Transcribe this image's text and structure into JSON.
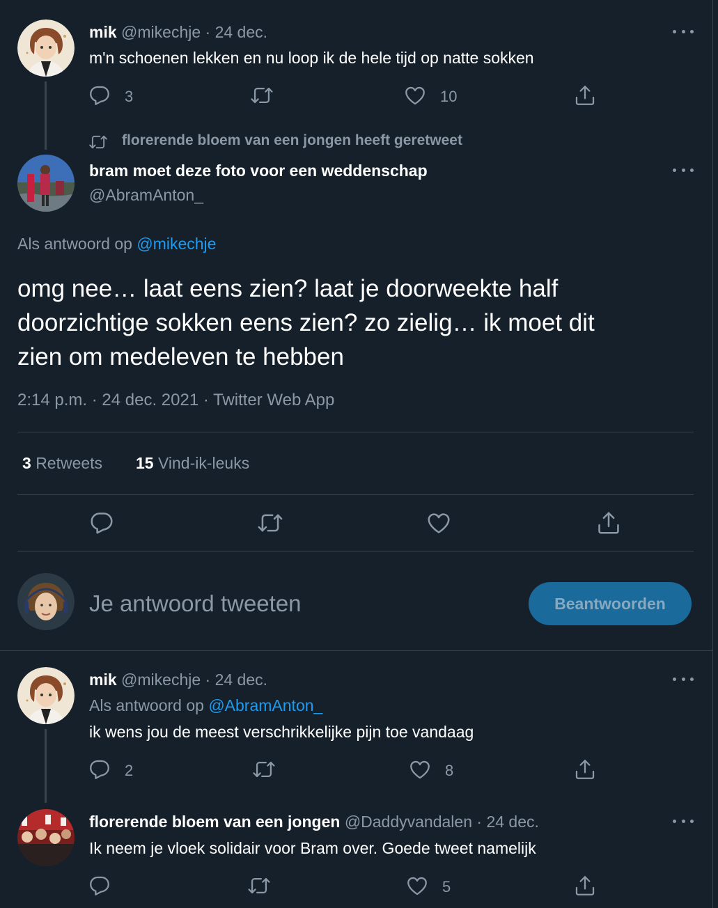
{
  "tweet1": {
    "name": "mik",
    "handle": "@mikechje",
    "date": "· 24 dec.",
    "text": "m'n schoenen lekken en nu loop ik de hele tijd op natte sokken",
    "reply_count": "3",
    "like_count": "10"
  },
  "retweet_banner": "florerende bloem van een jongen heeft geretweet",
  "main": {
    "name": "bram moet deze foto voor een weddenschap",
    "handle": "@AbramAnton_",
    "reply_prefix": "Als antwoord op",
    "reply_to": "@mikechje",
    "text_line1": "omg nee… laat eens zien? laat je doorweekte half",
    "text_line2": "doorzichtige sokken eens zien? zo zielig… ik moet dit",
    "text_line3": "zien om medeleven te hebben",
    "meta": "2:14 p.m. · 24 dec. 2021 · Twitter Web App",
    "retweets_count": "3",
    "retweets_label": "Retweets",
    "likes_count": "15",
    "likes_label": "Vind-ik-leuks"
  },
  "compose": {
    "placeholder": "Je antwoord tweeten",
    "button": "Beantwoorden"
  },
  "reply1": {
    "name": "mik",
    "handle": "@mikechje",
    "date": "· 24 dec.",
    "reply_prefix": "Als antwoord op",
    "reply_to": "@AbramAnton_",
    "text": "ik wens jou de meest verschrikkelijke pijn toe vandaag",
    "reply_count": "2",
    "like_count": "8"
  },
  "reply2": {
    "name": "florerende bloem van een jongen",
    "handle": "@Daddyvandalen",
    "date": "· 24 dec.",
    "text": "Ik neem je vloek solidair voor Bram over. Goede tweet namelijk",
    "like_count": "5"
  },
  "colors": {
    "background": "#15202b",
    "accent": "#1d9bf0",
    "muted": "#8b98a5",
    "divider": "#38444d",
    "button_bg": "#1a6a9c"
  }
}
